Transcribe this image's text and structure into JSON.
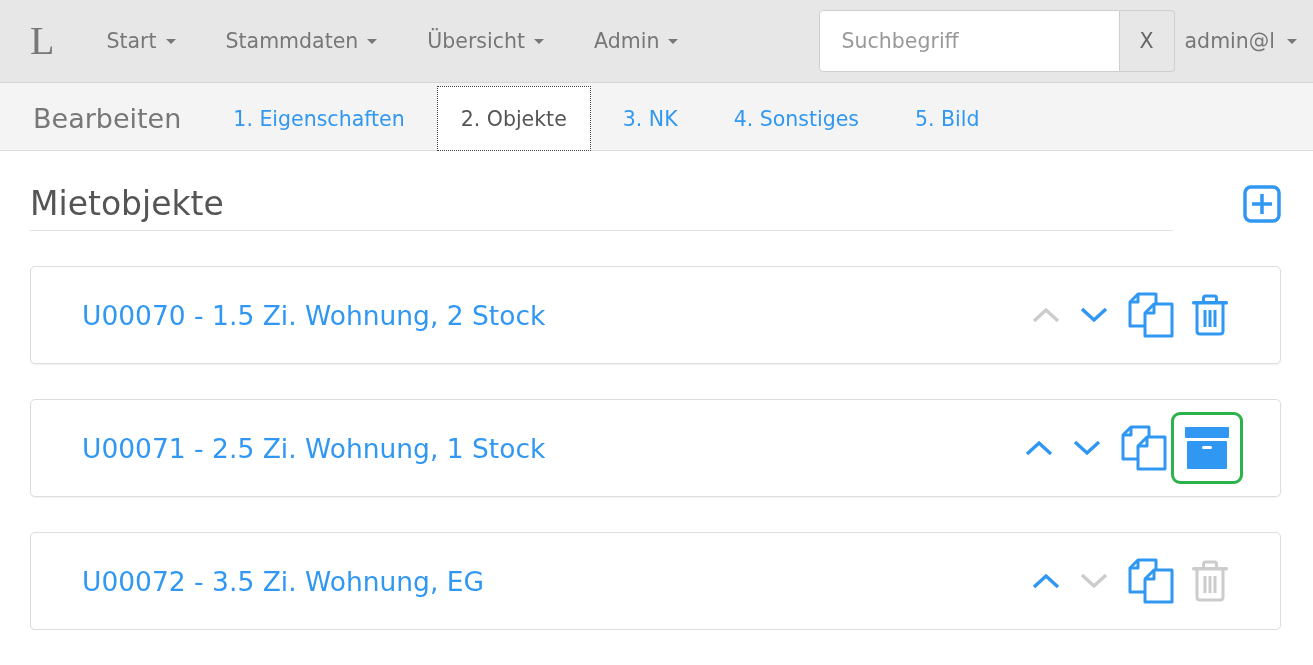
{
  "navbar": {
    "brand": "L",
    "menus": [
      {
        "label": "Start"
      },
      {
        "label": "Stammdaten"
      },
      {
        "label": "Übersicht"
      },
      {
        "label": "Admin"
      }
    ],
    "search": {
      "placeholder": "Suchbegriff",
      "clear_label": "X"
    },
    "user_menu": {
      "label": "admin@l"
    }
  },
  "subnav": {
    "title": "Bearbeiten",
    "tabs": [
      {
        "label": "1. Eigenschaften",
        "selected": false
      },
      {
        "label": "2. Objekte",
        "selected": true
      },
      {
        "label": "3. NK",
        "selected": false
      },
      {
        "label": "4. Sonstiges",
        "selected": false
      },
      {
        "label": "5. Bild",
        "selected": false
      }
    ]
  },
  "content": {
    "heading": "Mietobjekte",
    "rows": [
      {
        "title": "U00070 - 1.5 Zi. Wohnung, 2 Stock",
        "move_up": {
          "disabled": true
        },
        "move_down": {
          "disabled": false
        },
        "action": {
          "kind": "delete",
          "disabled": false,
          "highlighted": false
        }
      },
      {
        "title": "U00071 - 2.5 Zi. Wohnung, 1 Stock",
        "move_up": {
          "disabled": false
        },
        "move_down": {
          "disabled": false
        },
        "action": {
          "kind": "archive",
          "disabled": false,
          "highlighted": true
        }
      },
      {
        "title": "U00072 - 3.5 Zi. Wohnung, EG",
        "move_up": {
          "disabled": false
        },
        "move_down": {
          "disabled": true
        },
        "action": {
          "kind": "delete",
          "disabled": true,
          "highlighted": false
        }
      }
    ]
  }
}
